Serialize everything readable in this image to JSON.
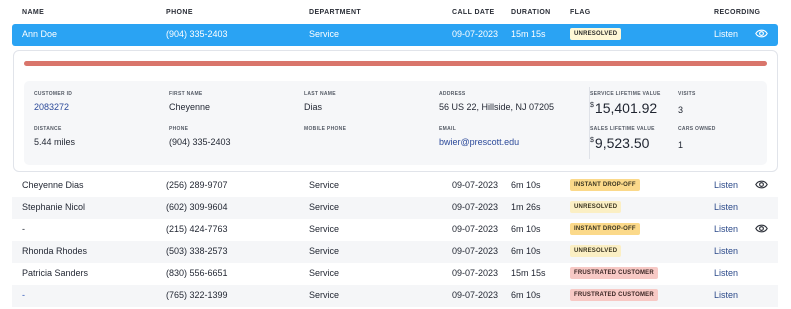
{
  "columns": {
    "name": "NAME",
    "phone": "PHONE",
    "department": "DEPARTMENT",
    "call_date": "CALL DATE",
    "duration": "DURATION",
    "flag": "FLAG",
    "recording": "RECORDING"
  },
  "selected_row": {
    "name": "Ann Doe",
    "phone": "(904) 335-2403",
    "department": "Service",
    "call_date": "09-07-2023",
    "duration": "15m 15s",
    "flag": "UNRESOLVED",
    "recording": "Listen",
    "has_eye": true
  },
  "detail": {
    "progress_color": "#d9756b",
    "customer_id": {
      "label": "CUSTOMER ID",
      "value": "2083272"
    },
    "first_name": {
      "label": "FIRST NAME",
      "value": "Cheyenne"
    },
    "last_name": {
      "label": "LAST NAME",
      "value": "Dias"
    },
    "address": {
      "label": "ADDRESS",
      "value": "56 US 22, Hillside, NJ 07205"
    },
    "service_lifetime_value": {
      "label": "SERVICE LIFETIME VALUE",
      "currency": "$",
      "value": "15,401.92"
    },
    "visits": {
      "label": "VISITS",
      "value": "3"
    },
    "distance": {
      "label": "DISTANCE",
      "value": "5.44 miles"
    },
    "phone": {
      "label": "PHONE",
      "value": "(904) 335-2403"
    },
    "mobile_phone": {
      "label": "MOBILE PHONE",
      "value": ""
    },
    "email": {
      "label": "EMAIL",
      "value": "bwier@prescott.edu"
    },
    "sales_lifetime_value": {
      "label": "SALES LIFETIME VALUE",
      "currency": "$",
      "value": "9,523.50"
    },
    "cars_owned": {
      "label": "CARS OWNED",
      "value": "1"
    }
  },
  "rows": [
    {
      "name": "Cheyenne Dias",
      "phone": "(256) 289-9707",
      "department": "Service",
      "call_date": "09-07-2023",
      "duration": "6m 10s",
      "flag": "INSTANT DROP-OFF",
      "flag_type": "dropoff",
      "recording": "Listen",
      "has_eye": true
    },
    {
      "name": "Stephanie Nicol",
      "phone": "(602) 309-9604",
      "department": "Service",
      "call_date": "09-07-2023",
      "duration": "1m 26s",
      "flag": "UNRESOLVED",
      "flag_type": "unresolved",
      "recording": "Listen",
      "has_eye": false
    },
    {
      "name": "-",
      "phone": "(215) 424-7763",
      "department": "Service",
      "call_date": "09-07-2023",
      "duration": "6m 10s",
      "flag": "INSTANT DROP-OFF",
      "flag_type": "dropoff",
      "recording": "Listen",
      "has_eye": true
    },
    {
      "name": "Rhonda Rhodes",
      "phone": "(503) 338-2573",
      "department": "Service",
      "call_date": "09-07-2023",
      "duration": "6m 10s",
      "flag": "UNRESOLVED",
      "flag_type": "unresolved",
      "recording": "Listen",
      "has_eye": false
    },
    {
      "name": "Patricia Sanders",
      "phone": "(830) 556-6651",
      "department": "Service",
      "call_date": "09-07-2023",
      "duration": "15m 15s",
      "flag": "FRUSTRATED CUSTOMER",
      "flag_type": "frustrated",
      "recording": "Listen",
      "has_eye": false
    },
    {
      "name": "-",
      "phone": "(765) 322-1399",
      "department": "Service",
      "call_date": "09-07-2023",
      "duration": "6m 10s",
      "flag": "FRUSTRATED CUSTOMER",
      "flag_type": "frustrated",
      "recording": "Listen",
      "has_eye": false
    }
  ]
}
